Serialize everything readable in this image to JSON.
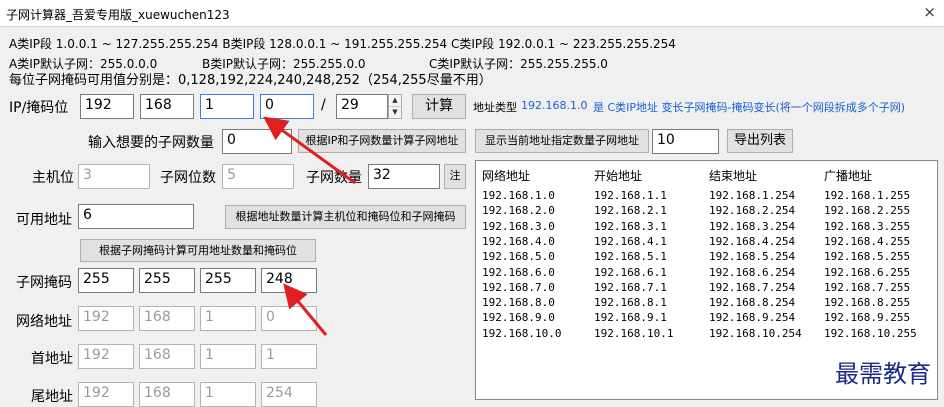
{
  "window": {
    "title": "子网计算器_吾爱专用版_xuewuchen123",
    "close": "×"
  },
  "info": {
    "line1": "A类IP段 1.0.0.1 ~ 127.255.255.254  B类IP段 128.0.0.1 ~ 191.255.255.254  C类IP段 192.0.0.1 ~ 223.255.255.254",
    "line2a": "A类IP默认子网：255.0.0.0",
    "line2b": "B类IP默认子网：255.255.0.0",
    "line2c": "C类IP默认子网：255.255.255.0",
    "line3": "每位子网掩码可用值分别是：0,128,192,224,240,248,252（254,255尽量不用）"
  },
  "ip": {
    "label": "IP/掩码位",
    "o1": "192",
    "o2": "168",
    "o3": "1",
    "o4": "0",
    "slash": "/",
    "mask": "29",
    "calc": "计算"
  },
  "addr_type": {
    "prefix": "地址类型",
    "value": "192.168.1.0",
    "desc": "是 C类IP地址  变长子网掩码-掩码变长(将一个网段拆成多个子网)"
  },
  "subnet_count": {
    "label": "输入想要的子网数量",
    "value": "0",
    "button": "根据IP和子网数量计算子网地址"
  },
  "show_subnets": {
    "button": "显示当前地址指定数量子网地址",
    "value": "10",
    "export": "导出列表"
  },
  "host_bits": {
    "label": "主机位",
    "value": "3"
  },
  "subnet_bits": {
    "label": "子网位数",
    "value": "5"
  },
  "subnet_num": {
    "label": "子网数量",
    "value": "32",
    "note": "注"
  },
  "usable": {
    "label": "可用地址",
    "value": "6",
    "button": "根据地址数量计算主机位和掩码位和子网掩码"
  },
  "calc_by_mask": {
    "button": "根据子网掩码计算可用地址数量和掩码位"
  },
  "mask_row": {
    "label": "子网掩码",
    "o1": "255",
    "o2": "255",
    "o3": "255",
    "o4": "248"
  },
  "network_row": {
    "label": "网络地址",
    "o1": "192",
    "o2": "168",
    "o3": "1",
    "o4": "0"
  },
  "first_row": {
    "label": "首地址",
    "o1": "192",
    "o2": "168",
    "o3": "1",
    "o4": "1"
  },
  "last_row": {
    "label": "尾地址",
    "o1": "192",
    "o2": "168",
    "o3": "1",
    "o4": "254"
  },
  "table": {
    "headers": [
      "网络地址",
      "开始地址",
      "结束地址",
      "广播地址"
    ],
    "rows": [
      [
        "192.168.1.0",
        "192.168.1.1",
        "192.168.1.254",
        "192.168.1.255"
      ],
      [
        "192.168.2.0",
        "192.168.2.1",
        "192.168.2.254",
        "192.168.2.255"
      ],
      [
        "192.168.3.0",
        "192.168.3.1",
        "192.168.3.254",
        "192.168.3.255"
      ],
      [
        "192.168.4.0",
        "192.168.4.1",
        "192.168.4.254",
        "192.168.4.255"
      ],
      [
        "192.168.5.0",
        "192.168.5.1",
        "192.168.5.254",
        "192.168.5.255"
      ],
      [
        "192.168.6.0",
        "192.168.6.1",
        "192.168.6.254",
        "192.168.6.255"
      ],
      [
        "192.168.7.0",
        "192.168.7.1",
        "192.168.7.254",
        "192.168.7.255"
      ],
      [
        "192.168.8.0",
        "192.168.8.1",
        "192.168.8.254",
        "192.168.8.255"
      ],
      [
        "192.168.9.0",
        "192.168.9.1",
        "192.168.9.254",
        "192.168.9.255"
      ],
      [
        "192.168.10.0",
        "192.168.10.1",
        "192.168.10.254",
        "192.168.10.255"
      ]
    ]
  },
  "watermark": "最需教育",
  "colors": {
    "accent_blue": "#1a5fd6",
    "arrow_red": "#e02020"
  }
}
